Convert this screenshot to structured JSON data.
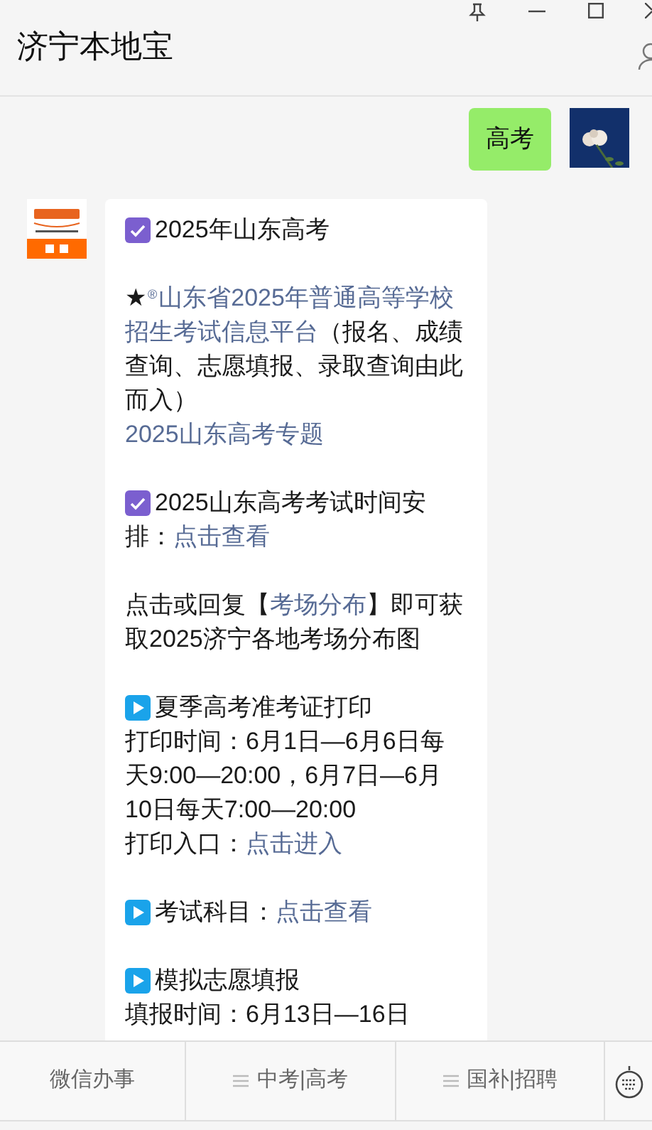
{
  "window": {
    "title": "济宁本地宝"
  },
  "messages": [
    {
      "kind": "outgoing",
      "text": "高考"
    },
    {
      "kind": "incoming",
      "paragraphs": [
        [
          [
            {
              "kind": "check"
            },
            {
              "kind": "text",
              "text": "2025年山东高考"
            }
          ]
        ],
        [
          [
            {
              "kind": "text",
              "text": "★"
            },
            {
              "kind": "sup",
              "text": "®"
            },
            {
              "kind": "link",
              "text": "山东省2025年普通高等学校"
            }
          ],
          [
            {
              "kind": "link",
              "text": "招生考试信息平台"
            },
            {
              "kind": "text",
              "text": "（报名、成绩"
            }
          ],
          [
            {
              "kind": "text",
              "text": "查询、志愿填报、录取查询由此"
            }
          ],
          [
            {
              "kind": "text",
              "text": "而入）"
            }
          ],
          [
            {
              "kind": "link",
              "text": "2025山东高考专题"
            }
          ]
        ],
        [
          [
            {
              "kind": "check"
            },
            {
              "kind": "text",
              "text": "2025山东高考考试时间安"
            }
          ],
          [
            {
              "kind": "text",
              "text": "排："
            },
            {
              "kind": "link",
              "text": "点击查看"
            }
          ]
        ],
        [
          [
            {
              "kind": "text",
              "text": "点击或回复【"
            },
            {
              "kind": "link",
              "text": "考场分布"
            },
            {
              "kind": "text",
              "text": "】即可获"
            }
          ],
          [
            {
              "kind": "text",
              "text": "取2025济宁各地考场分布图"
            }
          ]
        ],
        [
          [
            {
              "kind": "play"
            },
            {
              "kind": "text",
              "text": "夏季高考准考证打印"
            }
          ],
          [
            {
              "kind": "text",
              "text": "打印时间：6月1日—6月6日每"
            }
          ],
          [
            {
              "kind": "text",
              "text": "天9:00—20:00，6月7日—6月"
            }
          ],
          [
            {
              "kind": "text",
              "text": "10日每天7:00—20:00"
            }
          ],
          [
            {
              "kind": "text",
              "text": "打印入口："
            },
            {
              "kind": "link",
              "text": "点击进入"
            }
          ]
        ],
        [
          [
            {
              "kind": "play"
            },
            {
              "kind": "text",
              "text": "考试科目："
            },
            {
              "kind": "link",
              "text": "点击查看"
            }
          ]
        ],
        [
          [
            {
              "kind": "play"
            },
            {
              "kind": "text",
              "text": "模拟志愿填报"
            }
          ],
          [
            {
              "kind": "text",
              "text": "填报时间：6月13日—16日"
            }
          ]
        ]
      ]
    }
  ],
  "menu": [
    {
      "label": "微信办事",
      "icon": false
    },
    {
      "label": "中考|高考",
      "icon": true
    },
    {
      "label": "国补|招聘",
      "icon": true
    }
  ]
}
